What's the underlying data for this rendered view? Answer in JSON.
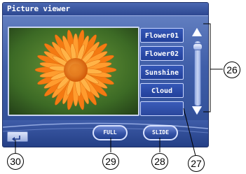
{
  "window": {
    "title": "Picture viewer"
  },
  "image_list": {
    "items": [
      {
        "label": "Flower01"
      },
      {
        "label": "Flower02"
      },
      {
        "label": "Sunshine"
      },
      {
        "label": "Cloud"
      },
      {
        "label": ""
      }
    ]
  },
  "controls": {
    "full_label": "FULL",
    "slide_label": "SLIDE"
  },
  "icons": {
    "back": "return-arrow-icon",
    "scroll_up": "triangle-up-icon",
    "scroll_down": "triangle-down-icon"
  },
  "callouts": {
    "c26": "26",
    "c27": "27",
    "c28": "28",
    "c29": "29",
    "c30": "30"
  }
}
